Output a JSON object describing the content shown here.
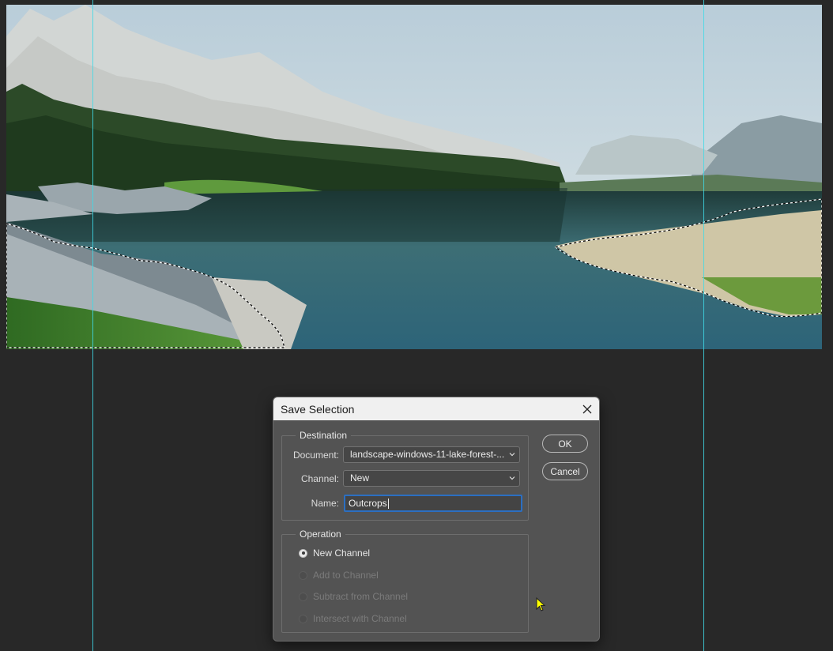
{
  "dialog": {
    "title": "Save Selection",
    "close_icon": "close-icon",
    "destination": {
      "legend": "Destination",
      "document_label": "Document:",
      "document_value": "landscape-windows-11-lake-forest-...",
      "channel_label": "Channel:",
      "channel_value": "New",
      "name_label": "Name:",
      "name_value": "Outcrops"
    },
    "operation": {
      "legend": "Operation",
      "options": [
        {
          "label": "New Channel",
          "selected": true,
          "enabled": true
        },
        {
          "label": "Add to Channel",
          "selected": false,
          "enabled": false
        },
        {
          "label": "Subtract from Channel",
          "selected": false,
          "enabled": false
        },
        {
          "label": "Intersect with Channel",
          "selected": false,
          "enabled": false
        }
      ]
    },
    "ok_label": "OK",
    "cancel_label": "Cancel"
  },
  "colors": {
    "workspace": "#282828",
    "guide": "#3fd9e6",
    "focus_border": "#2b6fc2",
    "cursor": "#ffff00"
  }
}
